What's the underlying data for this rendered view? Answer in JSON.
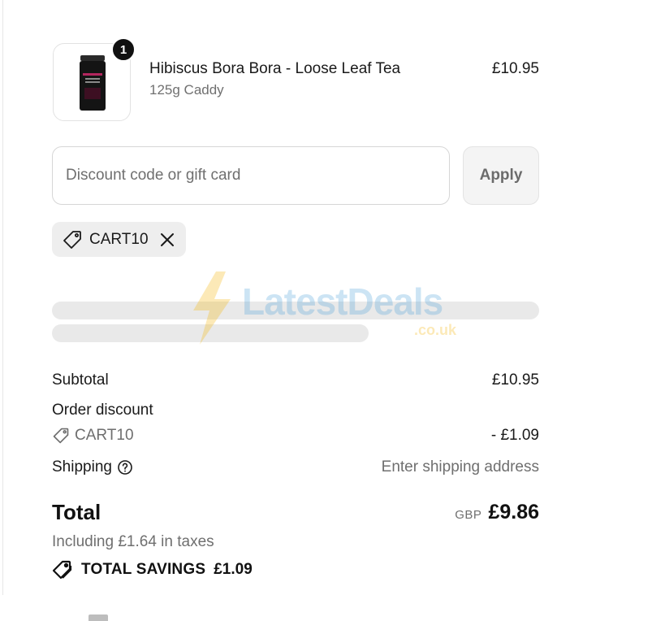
{
  "product": {
    "quantity": "1",
    "title": "Hibiscus Bora Bora - Loose Leaf Tea",
    "variant": "125g Caddy",
    "price": "£10.95",
    "image_icon": "tea-tin-icon"
  },
  "discount": {
    "placeholder": "Discount code or gift card",
    "value": "",
    "apply_label": "Apply",
    "applied_code": "CART10"
  },
  "watermark": {
    "text": "LatestDeals",
    "subtext": ".co.uk"
  },
  "summary": {
    "subtotal_label": "Subtotal",
    "subtotal_value": "£10.95",
    "order_discount_label": "Order discount",
    "discount_code": "CART10",
    "discount_value": "- £1.09",
    "shipping_label": "Shipping",
    "shipping_value": "Enter shipping address",
    "total_label": "Total",
    "currency": "GBP",
    "total_value": "£9.86",
    "tax_note": "Including £1.64 in taxes",
    "savings_label": "TOTAL SAVINGS",
    "savings_value": "£1.09"
  },
  "colors": {
    "text": "#1a1a1a",
    "muted": "#6f6f6f",
    "chip_bg": "#eeeeee",
    "skeleton": "#e9e9e9",
    "badge": "#111111"
  }
}
